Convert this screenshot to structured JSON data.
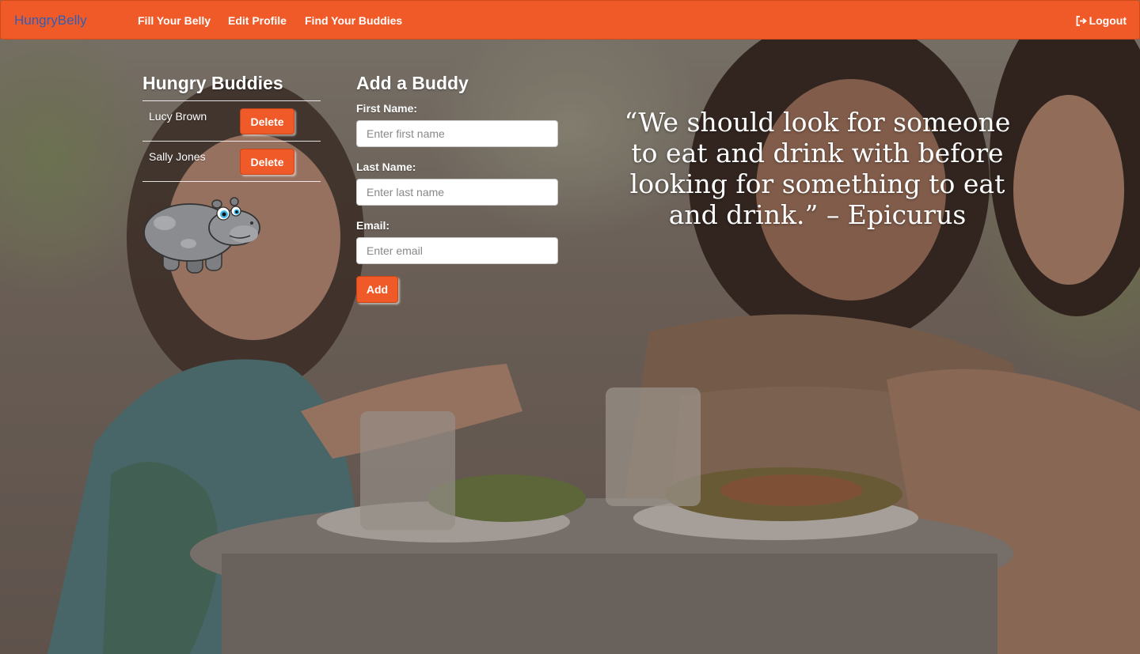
{
  "navbar": {
    "brand": "HungryBelly",
    "links": [
      "Fill Your Belly",
      "Edit Profile",
      "Find Your Buddies"
    ],
    "logout": "Logout",
    "logout_icon": "logout-icon",
    "color": "#f05a28",
    "brand_color": "#2e5fb8"
  },
  "buddies": {
    "title": "Hungry Buddies",
    "items": [
      {
        "name": "Lucy Brown",
        "action": "Delete"
      },
      {
        "name": "Sally Jones",
        "action": "Delete"
      }
    ],
    "mascot": "hippo-mascot"
  },
  "form": {
    "title": "Add a Buddy",
    "first_name": {
      "label": "First Name:",
      "placeholder": "Enter first name",
      "value": ""
    },
    "last_name": {
      "label": "Last Name:",
      "placeholder": "Enter last name",
      "value": ""
    },
    "email": {
      "label": "Email:",
      "placeholder": "Enter email",
      "value": ""
    },
    "submit": "Add"
  },
  "quote": {
    "text": "“We should look for someone to eat and drink with before looking for something to eat and drink.” – Epicurus"
  },
  "colors": {
    "accent": "#f05a28",
    "text_light": "#ffffff"
  }
}
